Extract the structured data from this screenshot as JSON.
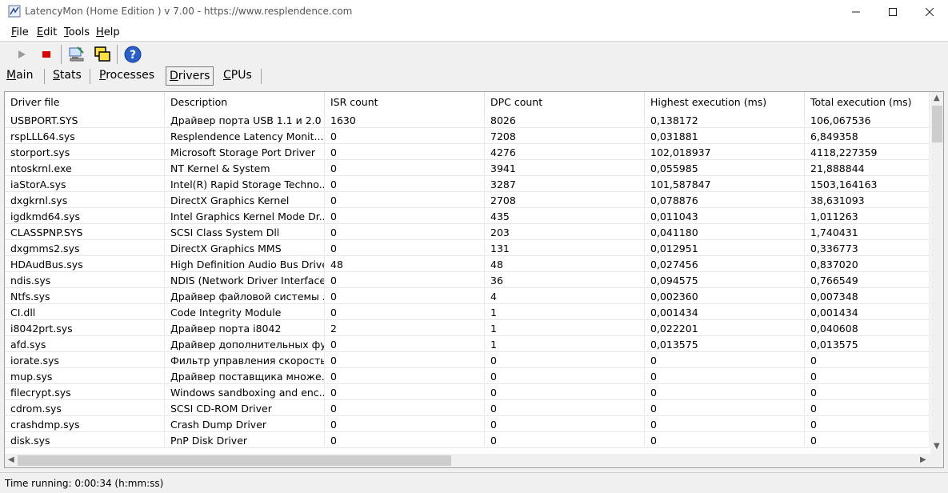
{
  "window": {
    "title": "LatencyMon  (Home Edition )  v 7.00 - https://www.resplendence.com"
  },
  "menu": [
    {
      "label": "File",
      "key": "F",
      "rest": "ile"
    },
    {
      "label": "Edit",
      "key": "E",
      "rest": "dit"
    },
    {
      "label": "Tools",
      "key": "T",
      "rest": "ools"
    },
    {
      "label": "Help",
      "key": "H",
      "rest": "elp"
    }
  ],
  "toolbar": {
    "start_icon": "play-icon",
    "stop_icon": "stop-icon",
    "monitor_icon": "computer-icon",
    "windows_icon": "windows-icon",
    "help_icon": "help-icon"
  },
  "tabs": [
    {
      "key": "M",
      "rest": "ain",
      "active": false
    },
    {
      "key": "S",
      "rest": "tats",
      "active": false
    },
    {
      "key": "P",
      "rest": "rocesses",
      "active": false
    },
    {
      "key": "D",
      "rest": "rivers",
      "active": true
    },
    {
      "key": "C",
      "rest": "PUs",
      "active": false
    }
  ],
  "table": {
    "columns": [
      "Driver file",
      "Description",
      "ISR count",
      "DPC count",
      "Highest execution (ms)",
      "Total execution (ms)"
    ],
    "rows": [
      [
        "USBPORT.SYS",
        "Драйвер порта USB 1.1 и 2.0",
        "1630",
        "8026",
        "0,138172",
        "106,067536"
      ],
      [
        "rspLLL64.sys",
        "Resplendence Latency Monit...",
        "0",
        "7208",
        "0,031881",
        "6,849358"
      ],
      [
        "storport.sys",
        "Microsoft Storage Port Driver",
        "0",
        "4276",
        "102,018937",
        "4118,227359"
      ],
      [
        "ntoskrnl.exe",
        "NT Kernel & System",
        "0",
        "3941",
        "0,055985",
        "21,888844"
      ],
      [
        "iaStorA.sys",
        "Intel(R) Rapid Storage Techno...",
        "0",
        "3287",
        "101,587847",
        "1503,164163"
      ],
      [
        "dxgkrnl.sys",
        "DirectX Graphics Kernel",
        "0",
        "2708",
        "0,078876",
        "38,631093"
      ],
      [
        "igdkmd64.sys",
        "Intel Graphics Kernel Mode Dr...",
        "0",
        "435",
        "0,011043",
        "1,011263"
      ],
      [
        "CLASSPNP.SYS",
        "SCSI Class System Dll",
        "0",
        "203",
        "0,041180",
        "1,740431"
      ],
      [
        "dxgmms2.sys",
        "DirectX Graphics MMS",
        "0",
        "131",
        "0,012951",
        "0,336773"
      ],
      [
        "HDAudBus.sys",
        "High Definition Audio Bus Driver",
        "48",
        "48",
        "0,027456",
        "0,837020"
      ],
      [
        "ndis.sys",
        "NDIS (Network Driver Interface...",
        "0",
        "36",
        "0,094575",
        "0,766549"
      ],
      [
        "Ntfs.sys",
        "Драйвер файловой системы ...",
        "0",
        "4",
        "0,002360",
        "0,007348"
      ],
      [
        "CI.dll",
        "Code Integrity Module",
        "0",
        "1",
        "0,001434",
        "0,001434"
      ],
      [
        "i8042prt.sys",
        "Драйвер порта i8042",
        "2",
        "1",
        "0,022201",
        "0,040608"
      ],
      [
        "afd.sys",
        "Драйвер дополнительных фу...",
        "0",
        "1",
        "0,013575",
        "0,013575"
      ],
      [
        "iorate.sys",
        "Фильтр управления скорость...",
        "0",
        "0",
        "0",
        "0"
      ],
      [
        "mup.sys",
        "Драйвер поставщика множе...",
        "0",
        "0",
        "0",
        "0"
      ],
      [
        "filecrypt.sys",
        "Windows sandboxing and enc...",
        "0",
        "0",
        "0",
        "0"
      ],
      [
        "cdrom.sys",
        "SCSI CD-ROM Driver",
        "0",
        "0",
        "0",
        "0"
      ],
      [
        "crashdmp.sys",
        "Crash Dump Driver",
        "0",
        "0",
        "0",
        "0"
      ],
      [
        "disk.sys",
        "PnP Disk Driver",
        "0",
        "0",
        "0",
        "0"
      ]
    ]
  },
  "statusbar": {
    "text": "Time running: 0:00:34  (h:mm:ss)"
  }
}
